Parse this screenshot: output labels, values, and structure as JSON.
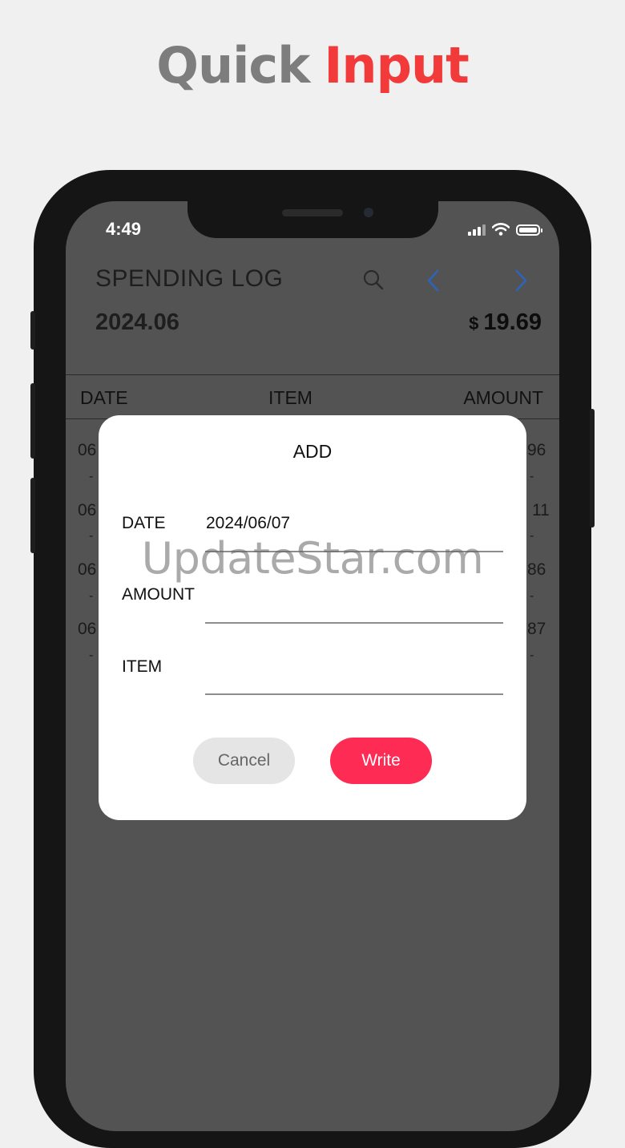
{
  "headline": {
    "word1": "Quick",
    "word2": "Input"
  },
  "status_bar": {
    "time": "4:49"
  },
  "app": {
    "title": "SPENDING LOG",
    "month": "2024.06",
    "total_currency": "$",
    "total_amount": "19.69"
  },
  "table": {
    "headers": {
      "date": "DATE",
      "item": "ITEM",
      "amount": "AMOUNT"
    },
    "rows": [
      {
        "date_frag": "06",
        "amount_frag": "96"
      },
      {
        "date_frag": "06",
        "amount_frag": "11"
      },
      {
        "date_frag": "06",
        "amount_frag": "86"
      },
      {
        "date_frag": "06",
        "amount_frag": "87"
      }
    ]
  },
  "dialog": {
    "title": "ADD",
    "date_label": "DATE",
    "date_value": "2024/06/07",
    "amount_label": "AMOUNT",
    "amount_value": "",
    "item_label": "ITEM",
    "item_value": "",
    "cancel_label": "Cancel",
    "write_label": "Write"
  },
  "watermark": "UpdateStar.com",
  "colors": {
    "accent": "#fe2b55",
    "headline_red": "#f23a3a",
    "nav_blue": "#2f63b8"
  }
}
